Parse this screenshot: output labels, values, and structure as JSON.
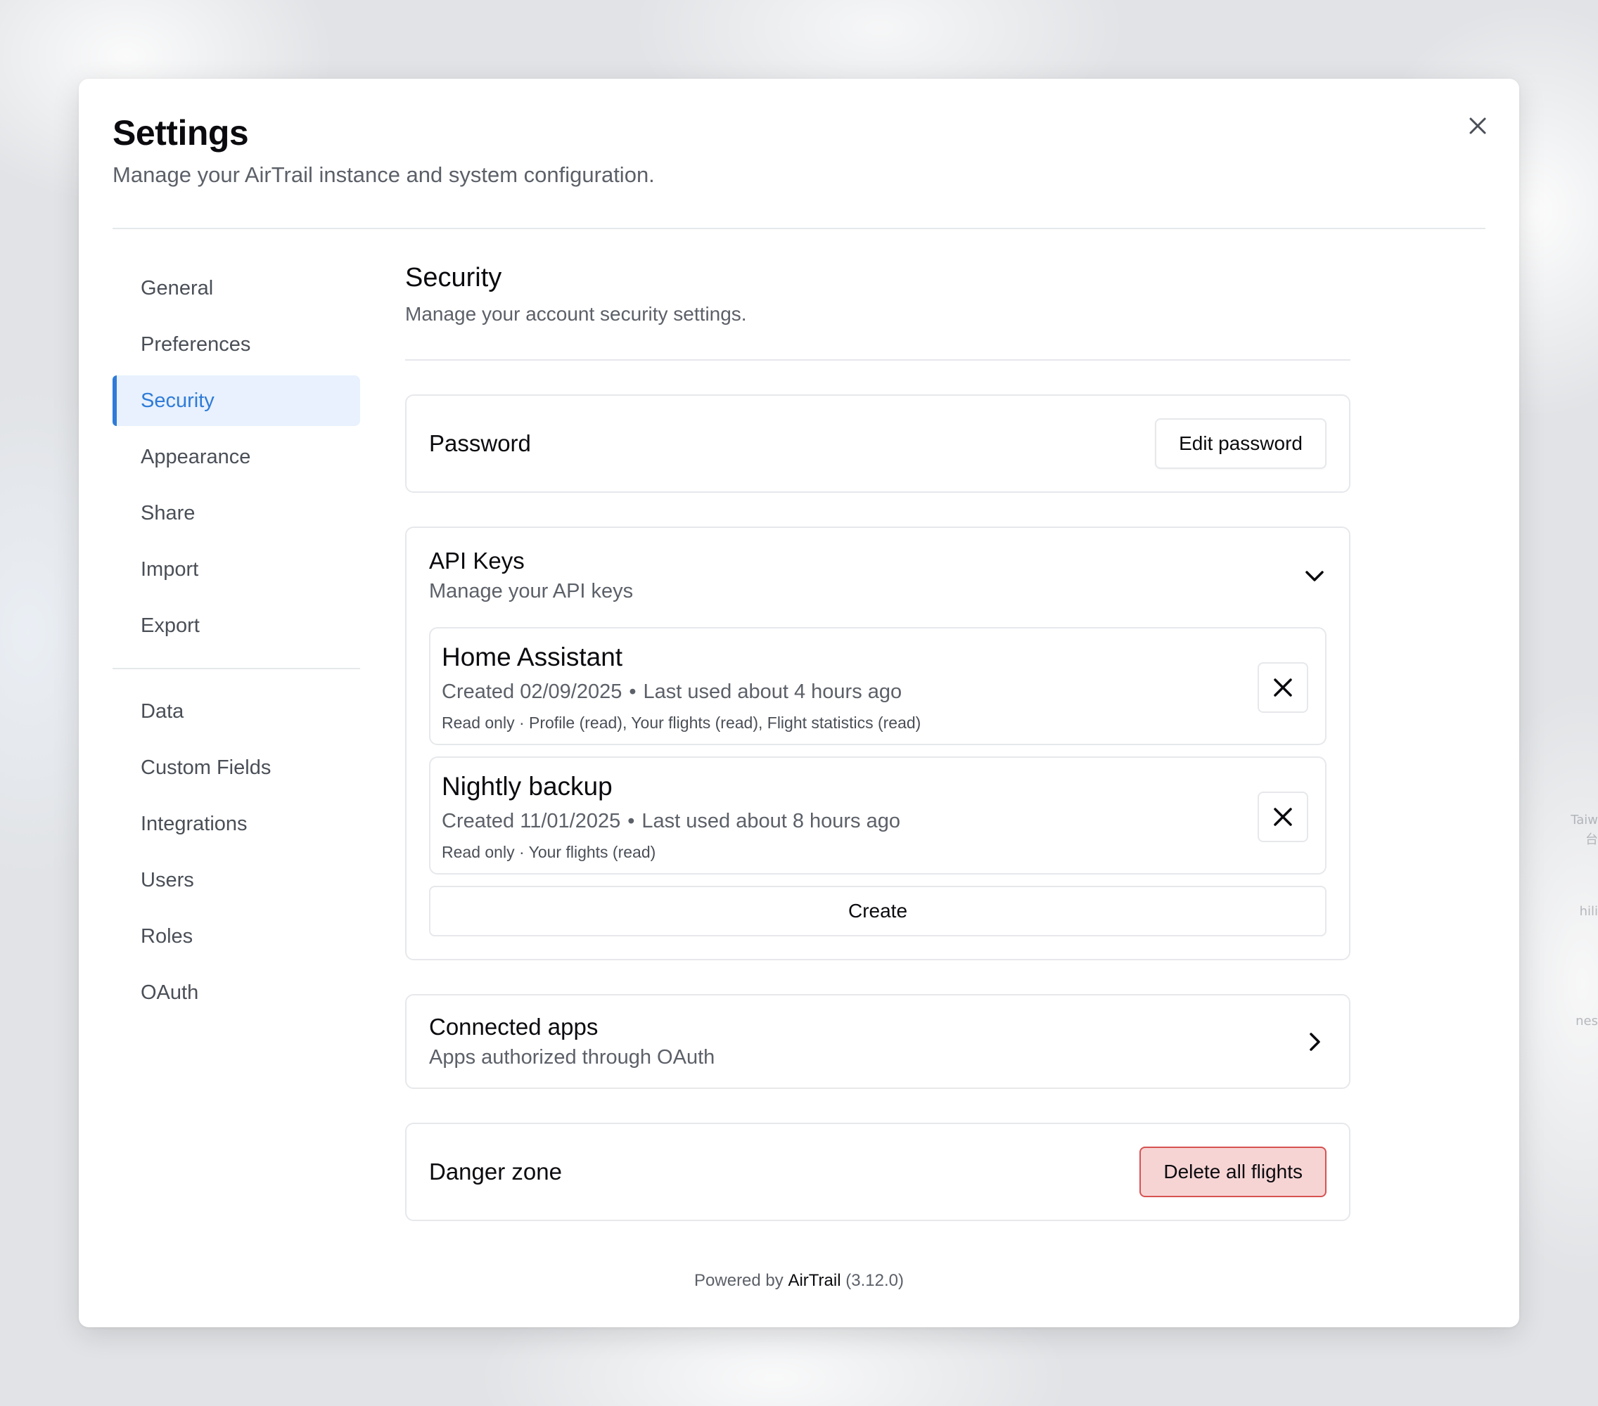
{
  "background": {
    "map_labels": [
      "Taiw",
      "台",
      "hili",
      "nes"
    ]
  },
  "dialog": {
    "title": "Settings",
    "subtitle": "Manage your AirTrail instance and system configuration.",
    "close_icon": "close-icon"
  },
  "sidebar": {
    "group1": [
      {
        "label": "General",
        "active": false
      },
      {
        "label": "Preferences",
        "active": false
      },
      {
        "label": "Security",
        "active": true
      },
      {
        "label": "Appearance",
        "active": false
      },
      {
        "label": "Share",
        "active": false
      },
      {
        "label": "Import",
        "active": false
      },
      {
        "label": "Export",
        "active": false
      }
    ],
    "group2": [
      {
        "label": "Data"
      },
      {
        "label": "Custom Fields"
      },
      {
        "label": "Integrations"
      },
      {
        "label": "Users"
      },
      {
        "label": "Roles"
      },
      {
        "label": "OAuth"
      }
    ]
  },
  "security": {
    "title": "Security",
    "subtitle": "Manage your account security settings.",
    "password": {
      "label": "Password",
      "button": "Edit password"
    },
    "api_keys": {
      "title": "API Keys",
      "subtitle": "Manage your API keys",
      "expanded_icon": "chevron-down-icon",
      "keys": [
        {
          "name": "Home Assistant",
          "created": "Created 02/09/2025",
          "last_used": "Last used about 4 hours ago",
          "scope": "Read only · Profile (read), Your flights (read), Flight statistics (read)"
        },
        {
          "name": "Nightly backup",
          "created": "Created 11/01/2025",
          "last_used": "Last used about 8 hours ago",
          "scope": "Read only · Your flights (read)"
        }
      ],
      "separator": "•",
      "create_button": "Create"
    },
    "connected_apps": {
      "title": "Connected apps",
      "subtitle": "Apps authorized through OAuth",
      "icon": "chevron-right-icon"
    },
    "danger_zone": {
      "label": "Danger zone",
      "button": "Delete all flights"
    }
  },
  "footer": {
    "prefix": "Powered by",
    "brand": "AirTrail",
    "version": "(3.12.0)"
  },
  "colors": {
    "accent": "#2f7bd8",
    "active_bg": "#e8f1fd",
    "danger_border": "#d65252",
    "danger_bg": "#f7d4d4",
    "muted_text": "#5c6068"
  }
}
